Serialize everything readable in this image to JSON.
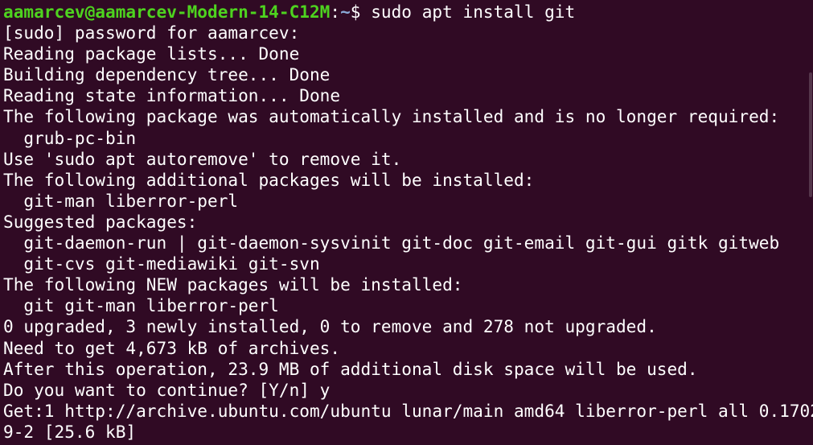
{
  "terminal": {
    "prompt": {
      "user_host": "aamarcev@aamarcev-Modern-14-C12M",
      "colon": ":",
      "cwd": "~",
      "symbol": "$ ",
      "command": "sudo apt install git"
    },
    "output": [
      "[sudo] password for aamarcev:",
      "Reading package lists... Done",
      "Building dependency tree... Done",
      "Reading state information... Done",
      "The following package was automatically installed and is no longer required:",
      "  grub-pc-bin",
      "Use 'sudo apt autoremove' to remove it.",
      "The following additional packages will be installed:",
      "  git-man liberror-perl",
      "Suggested packages:",
      "  git-daemon-run | git-daemon-sysvinit git-doc git-email git-gui gitk gitweb",
      "  git-cvs git-mediawiki git-svn",
      "The following NEW packages will be installed:",
      "  git git-man liberror-perl",
      "0 upgraded, 3 newly installed, 0 to remove and 278 not upgraded.",
      "Need to get 4,673 kB of archives.",
      "After this operation, 23.9 MB of additional disk space will be used.",
      "Do you want to continue? [Y/n] y",
      "Get:1 http://archive.ubuntu.com/ubuntu lunar/main amd64 liberror-perl all 0.1702",
      "9-2 [25.6 kB]"
    ]
  },
  "colors": {
    "background": "#300a24",
    "text": "#ffffff",
    "user_host": "#4ed31f",
    "cwd": "#8aa9d6"
  }
}
